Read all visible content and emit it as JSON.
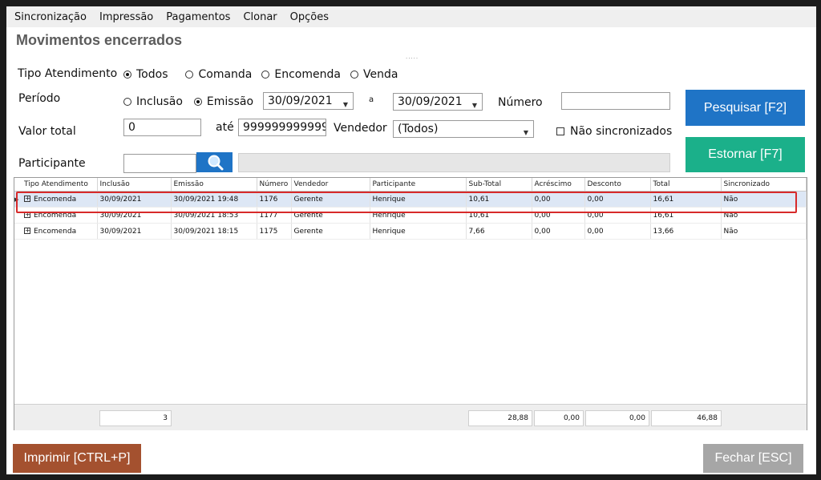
{
  "menu": [
    "Sincronização",
    "Impressão",
    "Pagamentos",
    "Clonar",
    "Opções"
  ],
  "page_title": "Movimentos encerrados",
  "dots": ".....",
  "tipo_atendimento": {
    "label": "Tipo Atendimento",
    "options": [
      {
        "label": "Todos",
        "checked": true
      },
      {
        "label": "Comanda",
        "checked": false
      },
      {
        "label": "Encomenda",
        "checked": false
      },
      {
        "label": "Venda",
        "checked": false
      }
    ]
  },
  "periodo": {
    "label": "Período",
    "options": [
      {
        "label": "Inclusão",
        "checked": false
      },
      {
        "label": "Emissão",
        "checked": true
      }
    ],
    "date_from": "30/09/2021",
    "separator": "a",
    "date_to": "30/09/2021"
  },
  "numero": {
    "label": "Número",
    "value": ""
  },
  "valor_total": {
    "label": "Valor total",
    "from": "0",
    "separator": "até",
    "to": "999999999999"
  },
  "vendedor": {
    "label": "Vendedor",
    "value": "(Todos)"
  },
  "nao_sincronizados": {
    "label": "Não sincronizados",
    "checked": false
  },
  "participante": {
    "label": "Participante",
    "code": "",
    "name": ""
  },
  "buttons": {
    "pesquisar": "Pesquisar [F2]",
    "estornar": "Estornar [F7]",
    "imprimir": "Imprimir [CTRL+P]",
    "fechar": "Fechar [ESC]"
  },
  "colors": {
    "pesquisar": "#1f74c6",
    "estornar": "#1bb08a",
    "imprimir": "#a4512f",
    "fechar": "#a6a6a6",
    "highlight": "#d72a2a"
  },
  "grid": {
    "columns": [
      "Tipo Atendimento",
      "Inclusão",
      "Emissão",
      "Número",
      "Vendedor",
      "Participante",
      "Sub-Total",
      "Acréscimo",
      "Desconto",
      "Total",
      "Sincronizado"
    ],
    "rows": [
      [
        "Encomenda",
        "30/09/2021",
        "30/09/2021 19:48",
        "1176",
        "Gerente",
        "Henrique",
        "10,61",
        "0,00",
        "0,00",
        "16,61",
        "Não"
      ],
      [
        "Encomenda",
        "30/09/2021",
        "30/09/2021 18:53",
        "1177",
        "Gerente",
        "Henrique",
        "10,61",
        "0,00",
        "0,00",
        "16,61",
        "Não"
      ],
      [
        "Encomenda",
        "30/09/2021",
        "30/09/2021 18:15",
        "1175",
        "Gerente",
        "Henrique",
        "7,66",
        "0,00",
        "0,00",
        "13,66",
        "Não"
      ]
    ],
    "selected_row": 0,
    "footer": {
      "count": "3",
      "subtotal": "28,88",
      "acrescimo": "0,00",
      "desconto": "0,00",
      "total": "46,88"
    }
  }
}
